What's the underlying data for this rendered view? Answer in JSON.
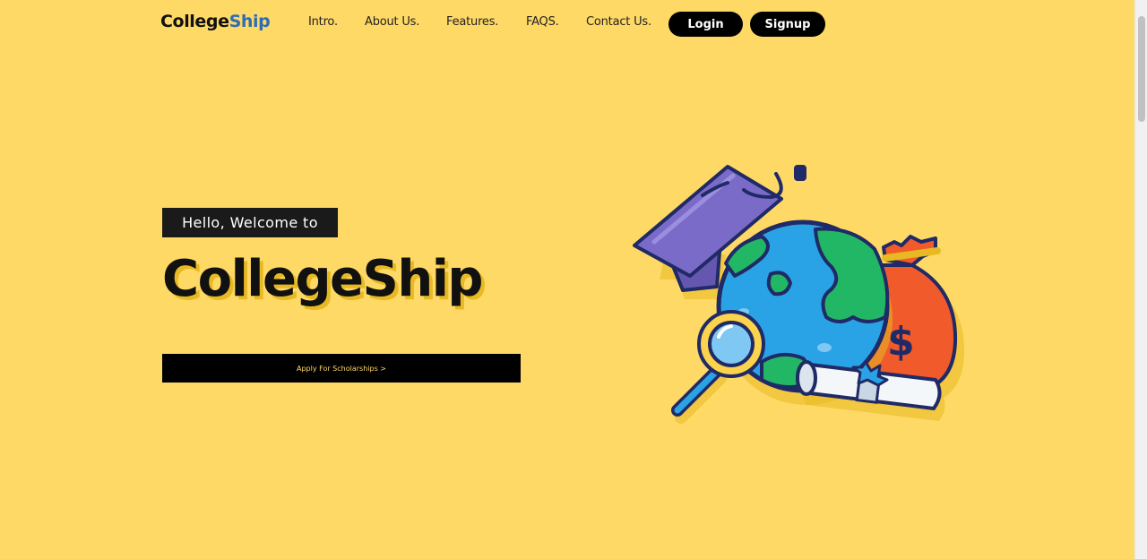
{
  "header": {
    "logo": {
      "part1": "College",
      "part2": "Ship"
    },
    "nav": [
      {
        "label": "Intro."
      },
      {
        "label": "About Us."
      },
      {
        "label": "Features."
      },
      {
        "label": "FAQS."
      },
      {
        "label": "Contact Us."
      }
    ],
    "login_label": "Login",
    "signup_label": "Signup"
  },
  "hero": {
    "greeting": "Hello, Welcome to",
    "title": "CollegeShip",
    "cta_label": "Apply For Scholarships >"
  },
  "illustration": {
    "icons": [
      "graduation-cap-icon",
      "globe-icon",
      "money-bag-icon",
      "dollar-sign-icon",
      "magnifying-glass-icon",
      "diploma-scroll-icon"
    ]
  },
  "colors": {
    "background": "#FFD966",
    "logo_accent": "#2E6DB4",
    "title_shadow": "#E8B923",
    "button": "#000000"
  }
}
